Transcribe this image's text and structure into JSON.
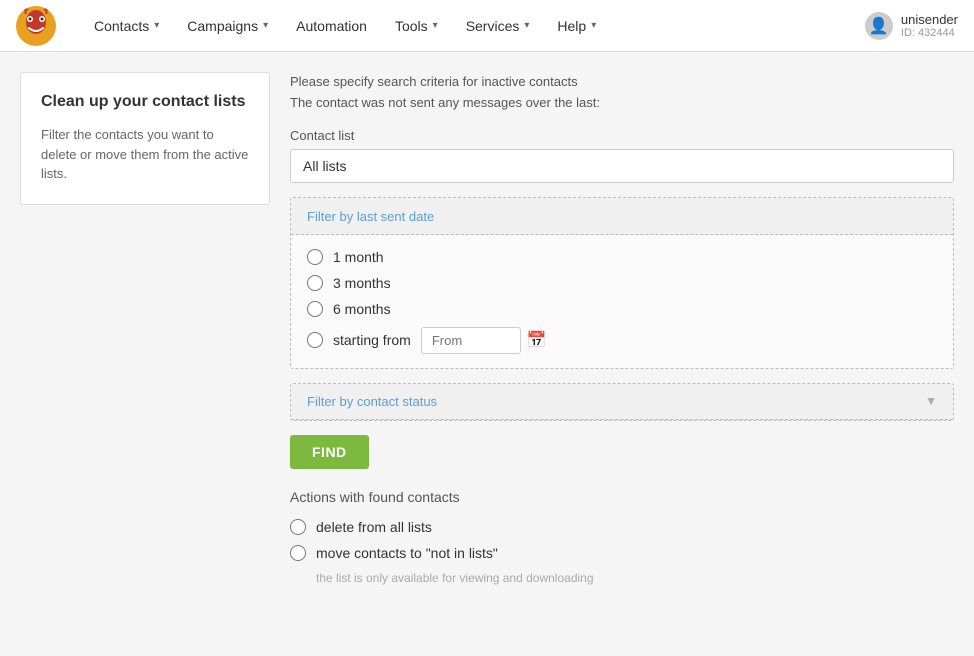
{
  "navbar": {
    "logo_alt": "Unisender Logo",
    "items": [
      {
        "label": "Contacts",
        "has_dropdown": true
      },
      {
        "label": "Campaigns",
        "has_dropdown": true
      },
      {
        "label": "Automation",
        "has_dropdown": false
      },
      {
        "label": "Tools",
        "has_dropdown": true
      },
      {
        "label": "Services",
        "has_dropdown": true
      },
      {
        "label": "Help",
        "has_dropdown": true
      }
    ],
    "user_name": "unisender",
    "user_id": "ID: 432444"
  },
  "sidebar": {
    "title": "Clean up your contact lists",
    "description": "Filter the contacts you want to delete or move them from the active lists."
  },
  "main": {
    "description_line1": "Please specify search criteria for inactive contacts",
    "description_line2": "The contact was not sent any messages over the last:",
    "contact_list_label": "Contact list",
    "contact_list_placeholder": "All lists",
    "filter_date": {
      "title": "Filter by last sent date",
      "options": [
        {
          "label": "1 month",
          "value": "1month"
        },
        {
          "label": "3 months",
          "value": "3months"
        },
        {
          "label": "6 months",
          "value": "6months"
        },
        {
          "label": "starting from",
          "value": "from"
        }
      ],
      "from_placeholder": "From"
    },
    "filter_status": {
      "title": "Filter by contact status"
    },
    "find_button": "FIND",
    "actions_label": "Actions with found contacts",
    "actions": [
      {
        "label": "delete from all lists",
        "value": "delete"
      },
      {
        "label": "move contacts to \"not in lists\"",
        "value": "move"
      }
    ],
    "action_note": "the list is only available for viewing and downloading"
  }
}
